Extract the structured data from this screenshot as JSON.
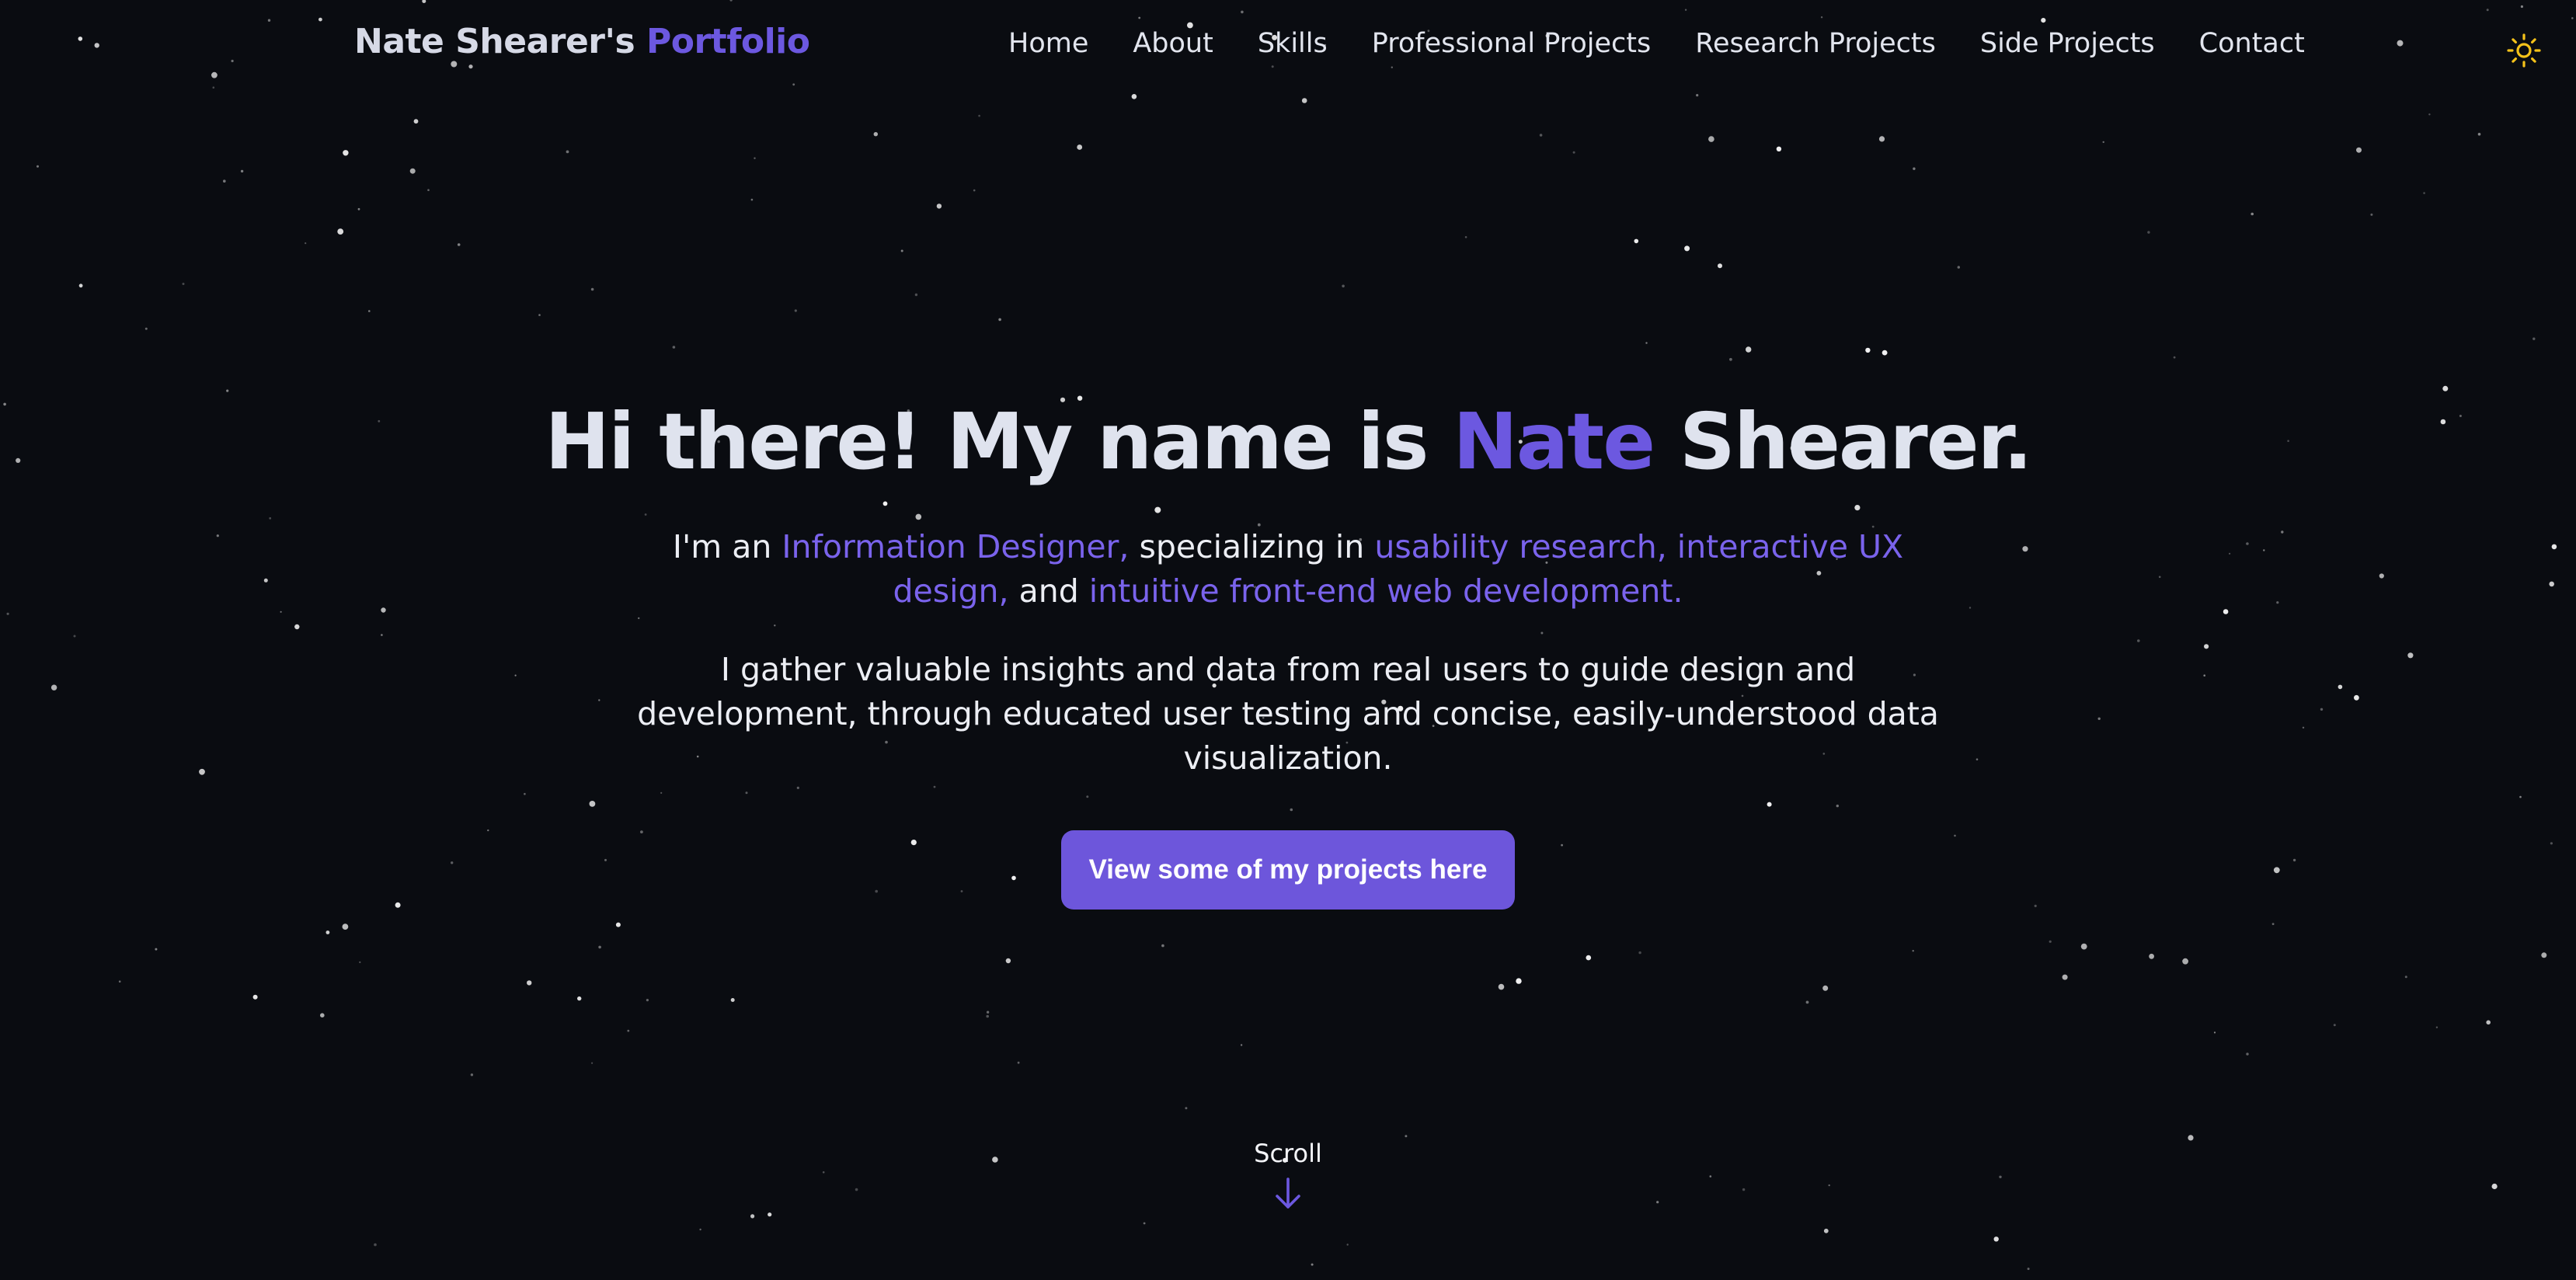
{
  "header": {
    "brand_name": "Nate Shearer's",
    "brand_accent": "Portfolio",
    "nav": [
      "Home",
      "About",
      "Skills",
      "Professional Projects",
      "Research Projects",
      "Side Projects",
      "Contact"
    ],
    "theme_toggle_icon": "sun-icon"
  },
  "hero": {
    "greeting": "Hi there! My name is",
    "first_name": "Nate",
    "last_name": "Shearer.",
    "intro_1": "I'm an",
    "role": "Information Designer,",
    "intro_2": "specializing in",
    "specialties_1": "usability research, interactive UX design,",
    "intro_3": "and",
    "specialties_2": "intuitive front-end web development.",
    "description": "I gather valuable insights and data from real users to guide design and development, through educated user testing and concise, easily-understood data visualization.",
    "cta_label": "View some of my projects here"
  },
  "scroll": {
    "label": "Scroll",
    "icon": "arrow-down-icon"
  },
  "colors": {
    "background": "#0a0c11",
    "accent": "#6c58e0",
    "button": "#6d56db",
    "sun": "#f5c21a"
  }
}
